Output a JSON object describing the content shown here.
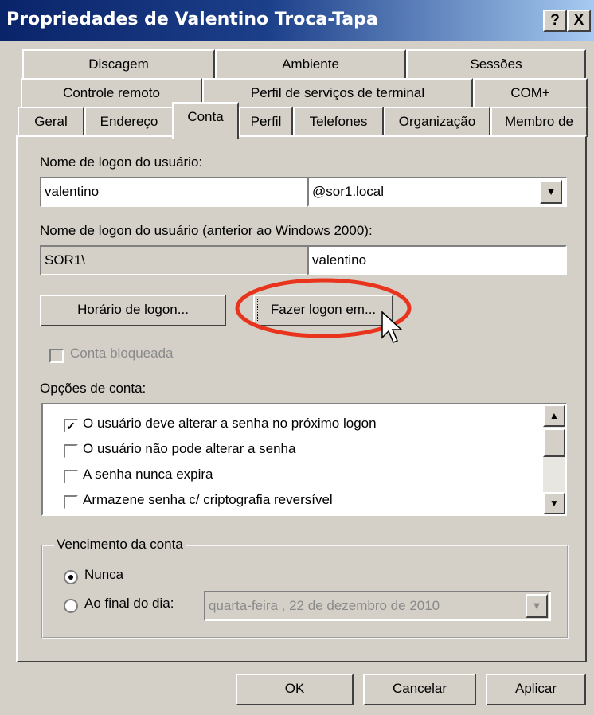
{
  "window": {
    "title": "Propriedades de Valentino Troca-Tapa",
    "help_label": "?",
    "close_label": "X"
  },
  "tabs": {
    "row1": [
      "Discagem",
      "Ambiente",
      "Sessões"
    ],
    "row2": [
      "Controle remoto",
      "Perfil de serviços de terminal",
      "COM+"
    ],
    "row3": [
      "Geral",
      "Endereço",
      "Conta",
      "Perfil",
      "Telefones",
      "Organização",
      "Membro de"
    ]
  },
  "conta": {
    "logon_label": "Nome de logon do usuário:",
    "logon_value": "valentino",
    "domain_value": "@sor1.local",
    "pre2000_label": "Nome de logon do usuário (anterior ao Windows 2000):",
    "pre2000_domain": "SOR1\\",
    "pre2000_user": "valentino",
    "logon_hours_button": "Horário de logon...",
    "logon_to_button": "Fazer logon em...",
    "locked_label": "Conta bloqueada",
    "options_label": "Opções de conta:",
    "options": [
      {
        "label": "O usuário deve alterar a senha no próximo logon",
        "checked": true
      },
      {
        "label": "O usuário não pode alterar a senha",
        "checked": false
      },
      {
        "label": "A senha nunca expira",
        "checked": false
      },
      {
        "label": "Armazene senha c/ criptografia reversível",
        "checked": false
      }
    ],
    "expires_group": "Vencimento da conta",
    "never_label": "Nunca",
    "end_of_label": "Ao final do dia:",
    "end_date": "quarta-feira  , 22 de dezembro de 2010"
  },
  "footer": {
    "ok": "OK",
    "cancel": "Cancelar",
    "apply": "Aplicar"
  },
  "colors": {
    "highlight_ring": "#e8341c",
    "titlebar": "#0a246a"
  },
  "icons": [
    "checkmark-icon",
    "dropdown-arrow-icon",
    "scroll-up-icon",
    "scroll-down-icon",
    "mouse-pointer-icon"
  ]
}
